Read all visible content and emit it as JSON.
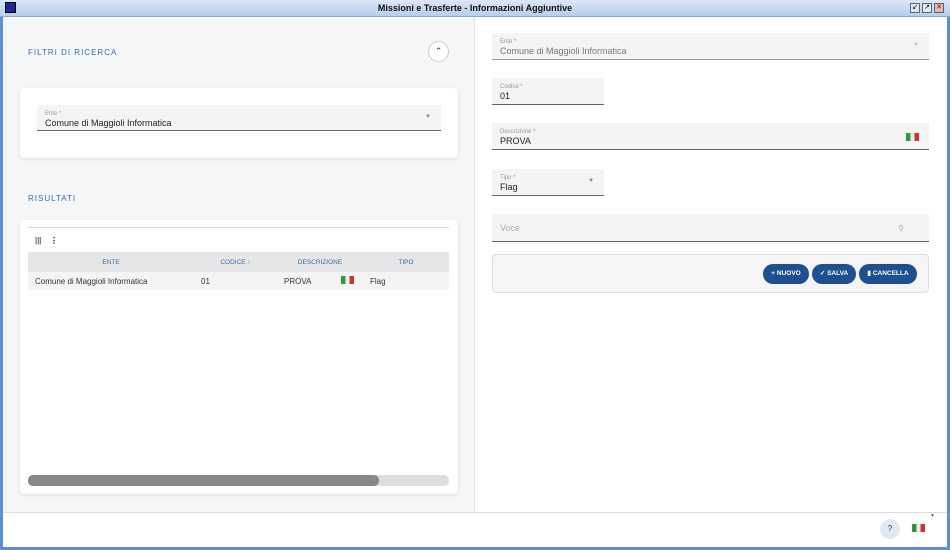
{
  "window": {
    "title": "Missioni e Trasferte - Informazioni Aggiuntive"
  },
  "filters": {
    "title": "FILTRI DI RICERCA",
    "ente_label": "Ente *",
    "ente_value": "Comune di Maggioli Informatica"
  },
  "results": {
    "title": "RISULTATI",
    "columns": [
      "ENTE",
      "CODICE",
      "DESCRIZIONE",
      "TIPO"
    ],
    "sort_indicator": "↑",
    "rows": [
      {
        "ente": "Comune di Maggioli Informatica",
        "codice": "01",
        "descrizione": "PROVA",
        "tipo": "Flag"
      }
    ]
  },
  "form": {
    "ente_label": "Ente *",
    "ente_value": "Comune di Maggioli Informatica",
    "codice_label": "Codice *",
    "codice_value": "01",
    "descrizione_label": "Descrizione *",
    "descrizione_value": "PROVA",
    "tipo_label": "Tipo *",
    "tipo_value": "Flag",
    "voce_placeholder": "Voce"
  },
  "buttons": {
    "nuovo": "NUOVO",
    "salva": "SALVA",
    "cancella": "CANCELLA"
  },
  "footer": {
    "help": "?"
  },
  "colors": {
    "accent": "#1e4f8f",
    "section": "#3a6ea5"
  }
}
